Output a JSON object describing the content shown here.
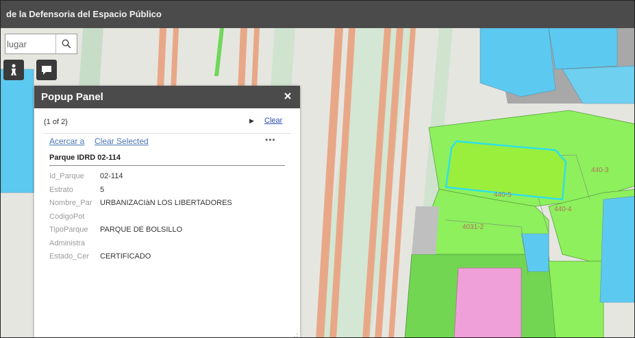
{
  "header": {
    "title": "de la Defensoria del Espacio Público"
  },
  "search": {
    "placeholder": "lugar",
    "icon": "search-icon"
  },
  "tools": [
    {
      "icon": "person-icon"
    },
    {
      "icon": "chat-icon"
    }
  ],
  "map_labels": {
    "lot_440_3": "440-3",
    "lot_440_5": "440-5",
    "lot_440_4": "440-4",
    "lot_4031_2": "4031-2"
  },
  "popup": {
    "title": "Popup Panel",
    "close_icon": "close-icon",
    "counter": "(1 of 2)",
    "next_icon": "play-icon",
    "clear_label": "Clear",
    "zoom_to_label": "Acercar a",
    "clear_selected_label": "Clear Selected",
    "more_label": "•••",
    "feature_title": "Parque IDRD 02-114",
    "attributes": [
      {
        "key": "Id_Parque",
        "value": "02-114"
      },
      {
        "key": "Estrato",
        "value": "5"
      },
      {
        "key": "Nombre_Par",
        "value": "URBANIZACIàN LOS LIBERTADORES"
      },
      {
        "key": "CodigoPot",
        "value": ""
      },
      {
        "key": "TipoParque",
        "value": "PARQUE DE BOLSILLO"
      },
      {
        "key": "Administra",
        "value": ""
      },
      {
        "key": "Estado_Cer",
        "value": "CERTIFICADO"
      }
    ]
  },
  "colors": {
    "header_bg": "#4b4b4b",
    "lot_green": "#8ef05c",
    "lot_blue": "#5ccaf0",
    "lot_pink": "#f0a0d8",
    "road_orange": "#e8a888",
    "highlight": "#2fe0e8",
    "link_blue": "#4a75b5"
  }
}
